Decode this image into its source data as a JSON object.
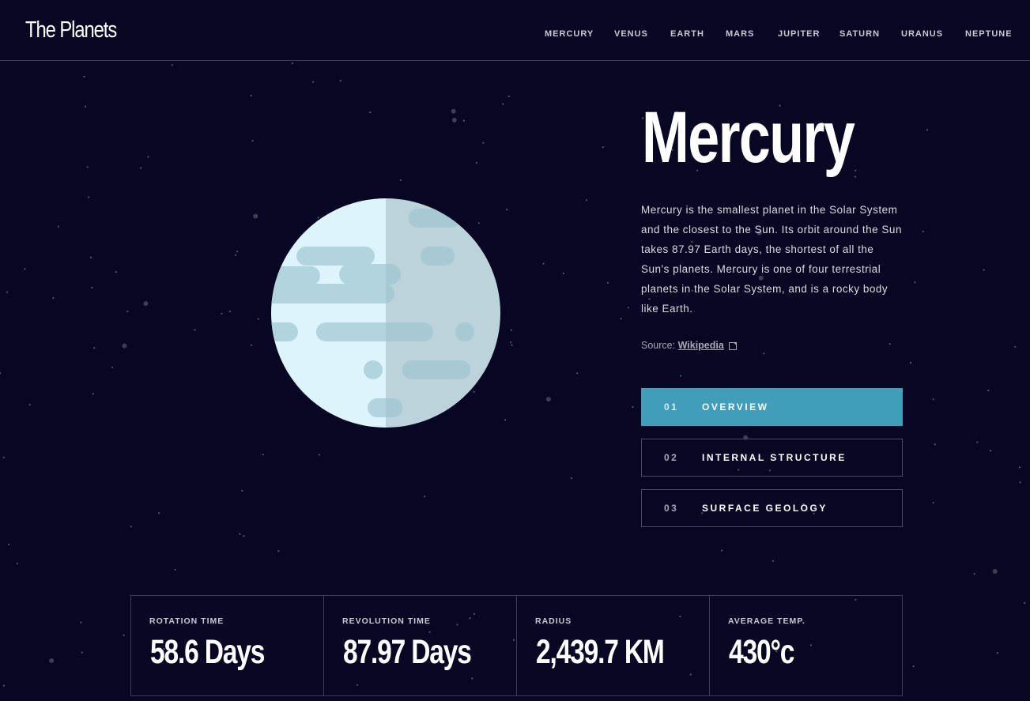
{
  "header": {
    "logo": "The Planets",
    "nav": [
      "MERCURY",
      "VENUS",
      "EARTH",
      "MARS",
      "JUPITER",
      "SATURN",
      "URANUS",
      "NEPTUNE"
    ]
  },
  "planet": {
    "name": "Mercury",
    "description": "Mercury is the smallest planet in the Solar System and the closest to the Sun. Its orbit around the Sun takes 87.97 Earth days, the shortest of all the Sun's planets. Mercury is one of four terrestrial planets in the Solar System, and is a rocky body like Earth.",
    "source_prefix": "Source:",
    "source_link": "Wikipedia",
    "planet_icon": "mercury-planet-illustration"
  },
  "tabs": [
    {
      "num": "01",
      "label": "OVERVIEW",
      "active": true
    },
    {
      "num": "02",
      "label": "INTERNAL STRUCTURE",
      "active": false
    },
    {
      "num": "03",
      "label": "SURFACE GEOLOGY",
      "active": false
    }
  ],
  "stats": [
    {
      "label": "ROTATION TIME",
      "value": "58.6 Days"
    },
    {
      "label": "REVOLUTION TIME",
      "value": "87.97 Days"
    },
    {
      "label": "RADIUS",
      "value": "2,439.7 KM"
    },
    {
      "label": "AVERAGE TEMP.",
      "value": "430°c"
    }
  ],
  "colors": {
    "background": "#070724",
    "accent": "#419ebb",
    "border": "#3b3b55",
    "planet_light": "#def4fc",
    "planet_shadow": "#c8dde5",
    "planet_crater": "#afd2de"
  }
}
